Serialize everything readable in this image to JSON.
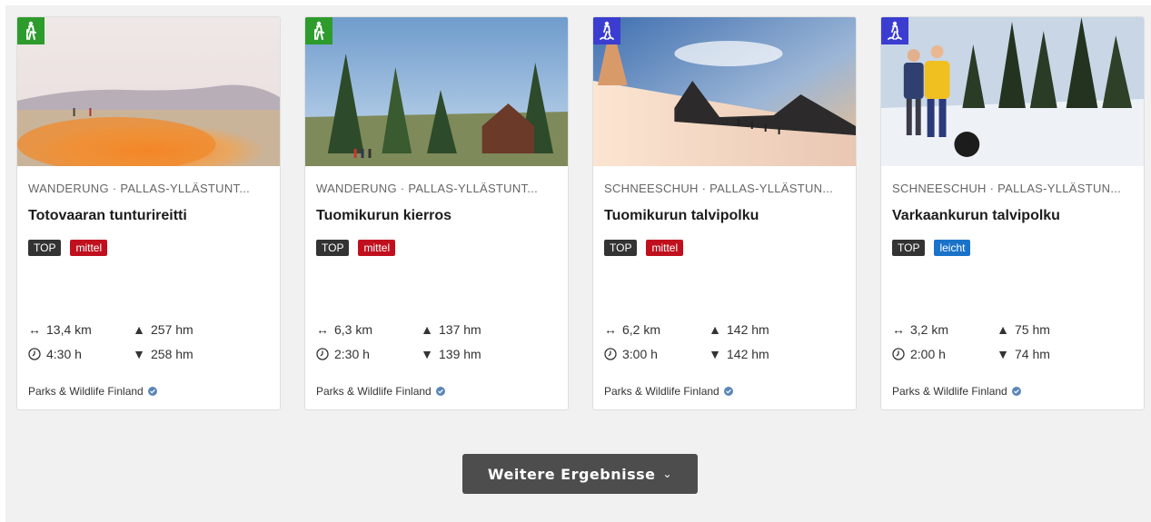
{
  "cards": [
    {
      "category_icon": "hiking-icon",
      "category": "WANDERUNG · PALLAS-YLLÄSTUNT...",
      "title": "Totovaaran tunturireitti",
      "tag_top": "TOP",
      "difficulty": "mittel",
      "distance": "13,4 km",
      "duration": "4:30 h",
      "ascent": "257 hm",
      "descent": "258 hm",
      "source": "Parks & Wildlife Finland"
    },
    {
      "category_icon": "hiking-icon",
      "category": "WANDERUNG · PALLAS-YLLÄSTUNT...",
      "title": "Tuomikurun kierros",
      "tag_top": "TOP",
      "difficulty": "mittel",
      "distance": "6,3 km",
      "duration": "2:30 h",
      "ascent": "137 hm",
      "descent": "139 hm",
      "source": "Parks & Wildlife Finland"
    },
    {
      "category_icon": "snowshoe-icon",
      "category": "SCHNEESCHUH · PALLAS-YLLÄSTUN...",
      "title": "Tuomikurun talvipolku",
      "tag_top": "TOP",
      "difficulty": "mittel",
      "distance": "6,2 km",
      "duration": "3:00 h",
      "ascent": "142 hm",
      "descent": "142 hm",
      "source": "Parks & Wildlife Finland"
    },
    {
      "category_icon": "snowshoe-icon",
      "category": "SCHNEESCHUH · PALLAS-YLLÄSTUN...",
      "title": "Varkaankurun talvipolku",
      "tag_top": "TOP",
      "difficulty": "leicht",
      "distance": "3,2 km",
      "duration": "2:00 h",
      "ascent": "75 hm",
      "descent": "74 hm",
      "source": "Parks & Wildlife Finland"
    }
  ],
  "more_button": {
    "label": "Weitere Ergebnisse"
  },
  "colors": {
    "hiking_badge": "#2d9c2d",
    "snowshoe_badge": "#3b3dd0",
    "difficulty_mittel": "#c0101e",
    "difficulty_leicht": "#1a73c9",
    "tag_top": "#333333",
    "button_bg": "#4d4d4d"
  }
}
